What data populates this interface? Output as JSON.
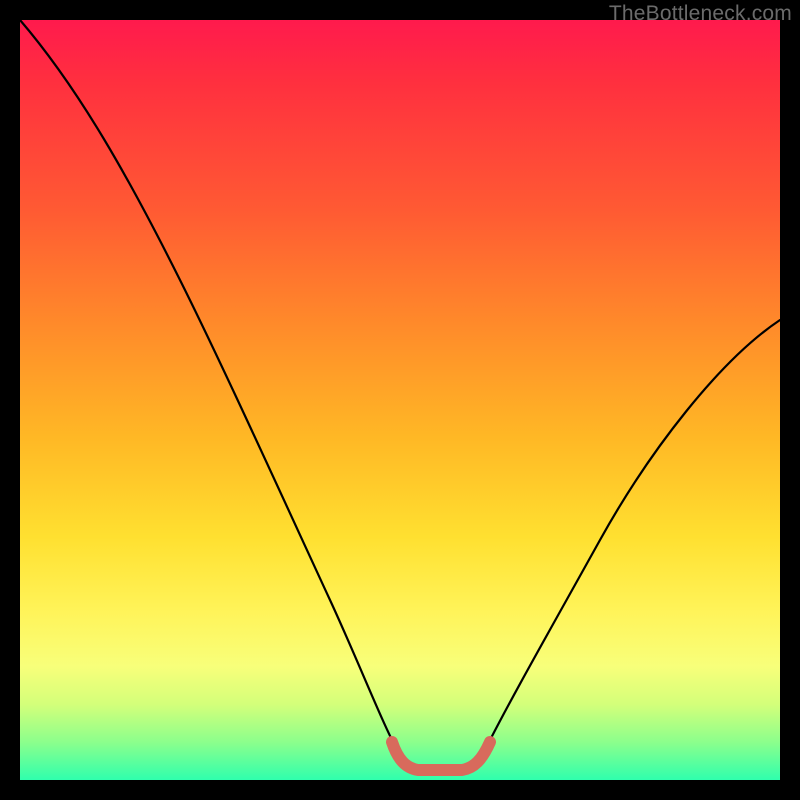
{
  "watermark": "TheBottleneck.com",
  "chart_data": {
    "type": "line",
    "title": "",
    "xlabel": "",
    "ylabel": "",
    "xlim": [
      0,
      100
    ],
    "ylim": [
      0,
      100
    ],
    "grid": false,
    "legend": false,
    "series": [
      {
        "name": "bottleneck-curve",
        "x": [
          0,
          6,
          12,
          18,
          24,
          30,
          36,
          42,
          48,
          50,
          52,
          55,
          58,
          60,
          66,
          72,
          80,
          88,
          96,
          100
        ],
        "values": [
          100,
          90,
          80,
          70,
          59,
          48,
          37,
          26,
          10,
          3,
          1,
          1,
          1,
          3,
          12,
          24,
          36,
          48,
          56,
          60
        ]
      },
      {
        "name": "highlight-band",
        "x": [
          48,
          50,
          52,
          55,
          58,
          60
        ],
        "values": [
          3,
          1,
          1,
          1,
          1,
          3
        ]
      }
    ],
    "annotations": []
  }
}
